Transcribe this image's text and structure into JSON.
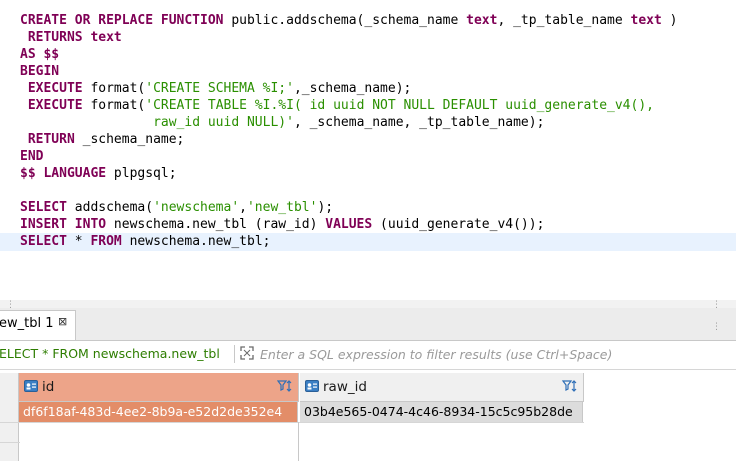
{
  "editor": {
    "lines": [
      [
        "CREATE OR REPLACE FUNCTION",
        " public.addschema(_schema_name ",
        "text",
        ", _tp_table_name ",
        "text",
        " )"
      ],
      [
        " RETURNS",
        " ",
        "text"
      ],
      [
        "AS $$"
      ],
      [
        "BEGIN"
      ],
      [
        " EXECUTE",
        " format(",
        "'CREATE SCHEMA %I;'",
        ",_schema_name);"
      ],
      [
        " EXECUTE",
        " format(",
        "'CREATE TABLE %I.%I( id uuid NOT NULL DEFAULT uuid_generate_v4(),"
      ],
      [
        "",
        "                 ",
        "raw_id uuid NULL)'",
        ", _schema_name, _tp_table_name);"
      ],
      [
        " RETURN",
        " _schema_name;"
      ],
      [
        "END"
      ],
      [
        "$$ LANGUAGE",
        " plpgsql;"
      ],
      [
        ""
      ],
      [
        "SELECT",
        " addschema(",
        "'newschema'",
        ",",
        "'new_tbl'",
        ");"
      ],
      [
        "INSERT INTO",
        " newschema.new_tbl (raw_id) ",
        "VALUES",
        " (uuid_generate_v4());"
      ],
      [
        "SELECT",
        " * ",
        "FROM",
        " newschema.new_tbl;"
      ]
    ]
  },
  "results": {
    "tab_label": "ew_tbl 1",
    "tab_close": "⊠",
    "filter_query": "ELECT * FROM newschema.new_tbl",
    "filter_placeholder": "Enter a SQL expression to filter results (use Ctrl+Space)",
    "columns": [
      {
        "name": "id",
        "icon": "key-column-icon"
      },
      {
        "name": "raw_id",
        "icon": "column-icon"
      }
    ],
    "rows": [
      [
        "df6f18af-483d-4ee2-8b9a-e52d2de352e4",
        "03b4e565-0474-4c46-8934-15c5c95b28de"
      ]
    ]
  },
  "colors": {
    "keyword": "#7f0055",
    "string": "#2a8f00",
    "selected_header": "#eda489",
    "selected_cell": "#e38d68",
    "filter_query": "#2d7d00"
  }
}
